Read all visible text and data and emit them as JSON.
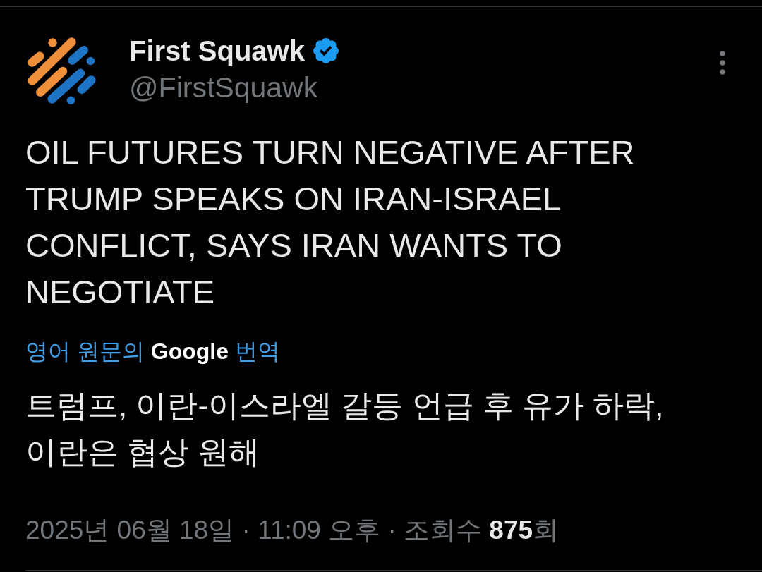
{
  "author": {
    "name": "First Squawk",
    "verified": true,
    "handle": "@FirstSquawk"
  },
  "post": {
    "text": "OIL FUTURES TURN NEGATIVE AFTER TRUMP SPEAKS ON IRAN-ISRAEL CONFLICT, SAYS IRAN WANTS TO NEGOTIATE",
    "translation_credit": "영어 원문의 **Google** 번역",
    "translation": "트럼프, 이란-이스라엘 갈등 언급 후 유가 하락, 이란은 협상 원해",
    "meta": "2025년 06월 18일 · 11:09 오후 · 조회수 **875**회"
  }
}
